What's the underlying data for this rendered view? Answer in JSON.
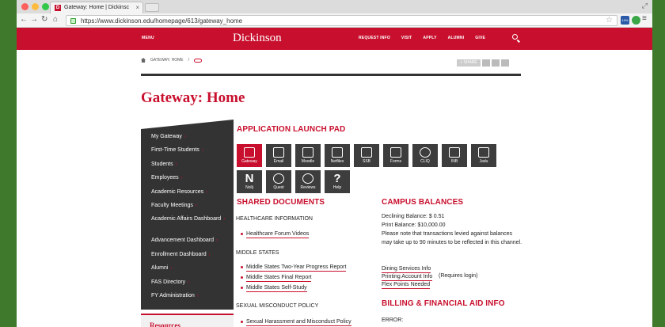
{
  "browser": {
    "tab_title": "Gateway: Home | Dickinsc",
    "tab_close": "×",
    "url": "https://www.dickinson.edu/homepage/613/gateway_home",
    "back": "←",
    "forward": "→",
    "reload": "↻",
    "home": "⌂",
    "star": "☆",
    "resize": "⤢",
    "ext_label": "10%"
  },
  "topnav": {
    "menu": "MENU",
    "logo": "Dickinson",
    "links": [
      "REQUEST INFO",
      "VISIT",
      "APPLY",
      "ALUMNI",
      "GIVE"
    ]
  },
  "breadcrumb": {
    "current": "GATEWAY: HOME",
    "separator": "/"
  },
  "share_label": "+ SHARE",
  "page_title": "Gateway: Home",
  "sidebar": [
    "My Gateway",
    "First-Time Students",
    "Students",
    "Employees",
    "Academic Resources",
    "Faculty Meetings",
    "Academic Affairs Dashboard",
    "Advancement Dashboard",
    "Enrollment Dashboard",
    "Alumni",
    "FAS Directory",
    "FY Administration"
  ],
  "sidebar_arrow": "›",
  "resources_heading": "Resources",
  "launch_pad": {
    "heading": "APPLICATION LAUNCH PAD",
    "apps": [
      "Gateway",
      "Email",
      "Moodle",
      "Netfiles",
      "SSB",
      "Forms",
      "CLIQ",
      "INB",
      "Jadu",
      "Nolij",
      "Quest",
      "Reviews",
      "Help"
    ]
  },
  "shared_docs": {
    "heading": "SHARED DOCUMENTS",
    "cat1": "HEALTHCARE INFORMATION",
    "cat1_links": [
      "Healthcare Forum Videos"
    ],
    "cat2": "MIDDLE STATES",
    "cat2_links": [
      "Middle States Two-Year Progress Report",
      "Middle States Final Report",
      "Middle States Self-Study"
    ],
    "cat3": "SEXUAL MISCONDUCT POLICY",
    "cat3_links": [
      "Sexual Harassment and Misconduct Policy"
    ]
  },
  "campus_balances": {
    "heading": "CAMPUS BALANCES",
    "declining": "Declining Balance: $ 0.51",
    "print": "Print Balance: $10,000.00",
    "note": "Please note that transactions levied against balances may take up to 90 minutes to be reflected in this channel.",
    "dining": "Dining Services Info",
    "printing": "Printing Account Info",
    "printing_suffix": " (Requires login)",
    "flex": "Flex Points Needed"
  },
  "billing": {
    "heading": "BILLING & FINANCIAL AID INFO",
    "error": "ERROR:"
  },
  "colors": {
    "brand": "#c8102e",
    "dark": "#333333"
  }
}
